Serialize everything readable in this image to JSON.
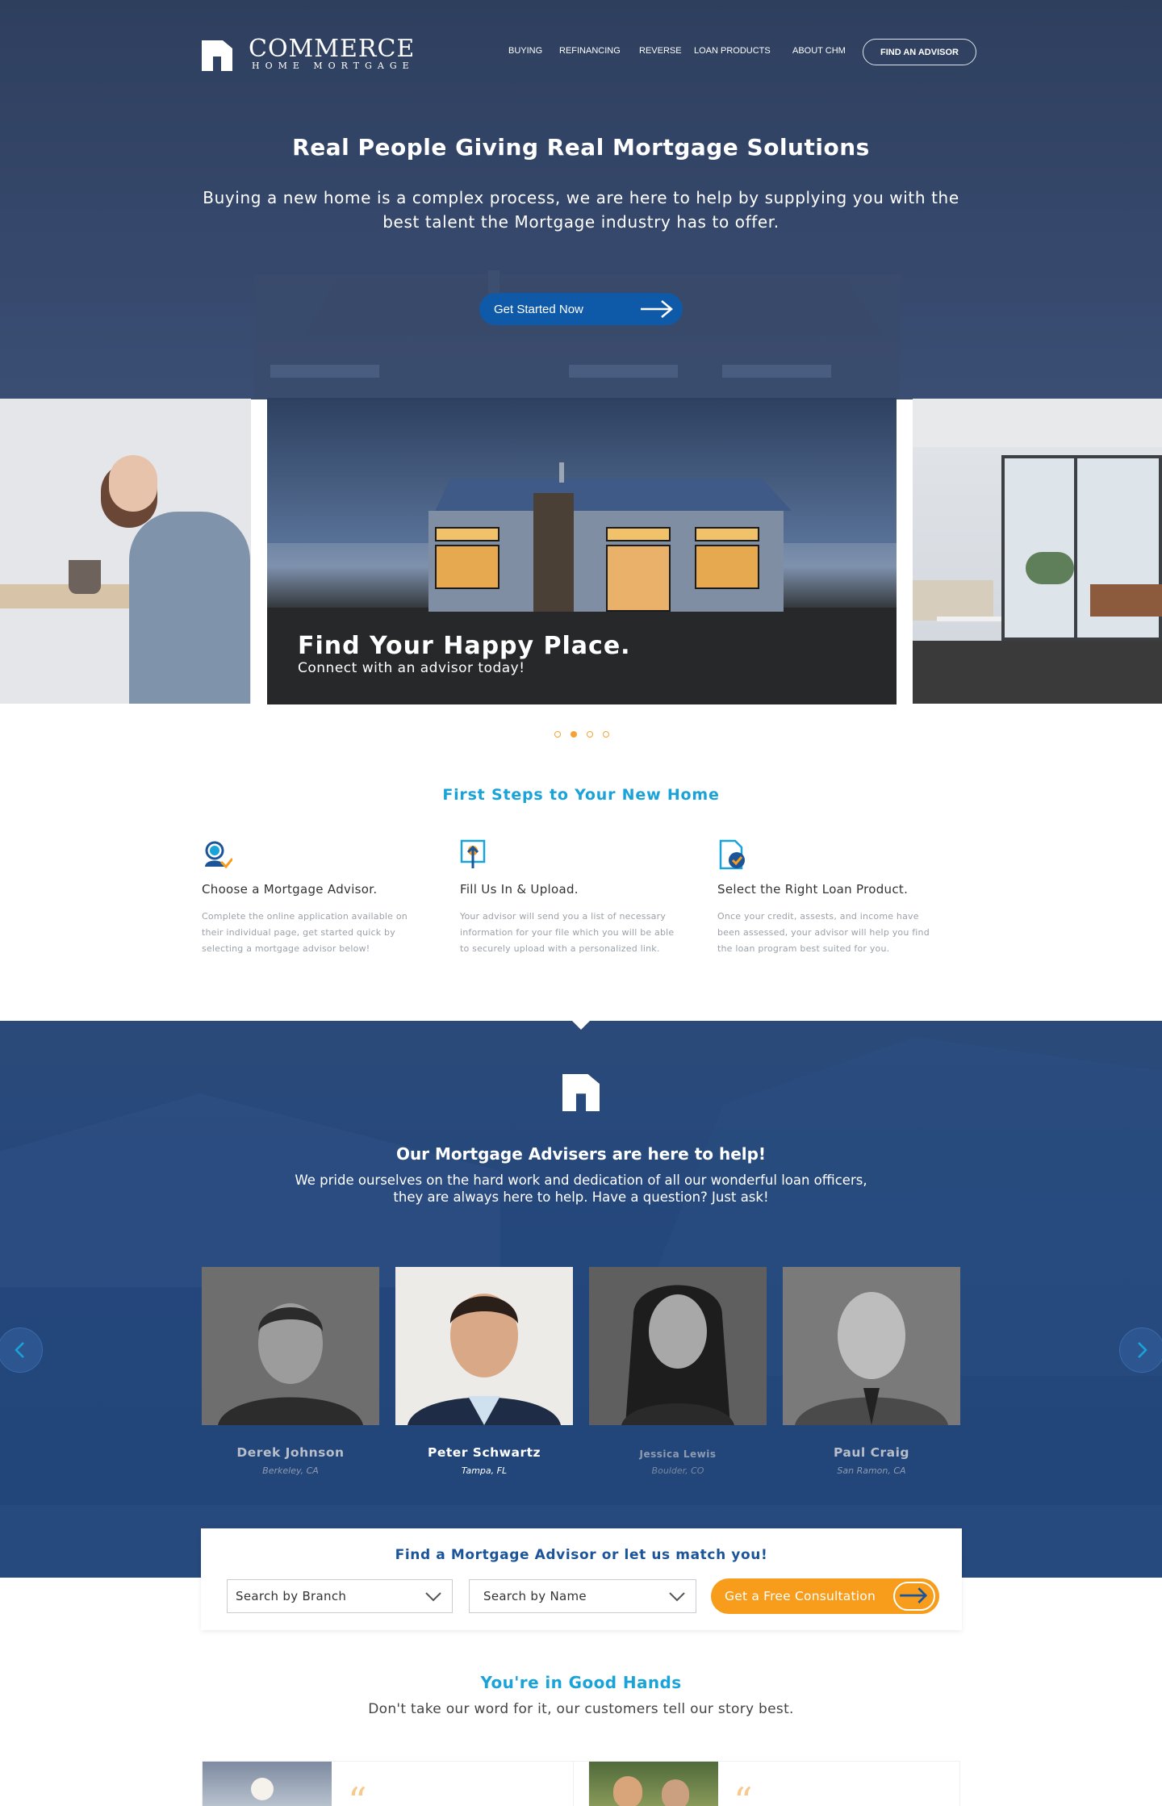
{
  "brand": {
    "name": "COMMERCE",
    "tagline": "HOME MORTGAGE",
    "logo_icon": "house-logo-icon",
    "colors": {
      "navy": "#2e3f5e",
      "blue": "#0f5aa8",
      "cyan": "#1aa3d8",
      "orange": "#f79d1b"
    }
  },
  "nav": {
    "items": [
      "BUYING",
      "REFINANCING",
      "REVERSE",
      "LOAN PRODUCTS",
      "ABOUT CHM"
    ],
    "cta": "FIND AN ADVISOR"
  },
  "hero": {
    "title": "Real People Giving Real Mortgage Solutions",
    "subtitle": "Buying a new home is a complex process, we are here to help by supplying you with the best talent the Mortgage industry has to offer.",
    "cta": "Get Started Now"
  },
  "carousel": {
    "title": "Find Your Happy Place.",
    "subtitle": "Connect with an advisor today!",
    "active_index": 1,
    "dot_count": 4
  },
  "steps": {
    "title": "First Steps to Your New Home",
    "items": [
      {
        "icon": "advisor-headset-icon",
        "title": "Choose a Mortgage Advisor.",
        "body": "Complete the online application available on their individual page, get started quick by selecting a mortgage advisor below!"
      },
      {
        "icon": "upload-icon",
        "title": "Fill Us In & Upload.",
        "body": "Your advisor will send you a list of necessary information for your file which you will be able to securely upload with a personalized link."
      },
      {
        "icon": "document-check-icon",
        "title": "Select the Right Loan Product.",
        "body": "Once your credit, assests, and income have been assessed, your advisor will help you find the loan program best suited for you."
      }
    ]
  },
  "advisors": {
    "title": "Our Mortgage Advisers are here to help!",
    "subtitle": "We pride ourselves on the hard work and dedication of all our wonderful loan officers, they are always here to help. Have a question? Just ask!",
    "people": [
      {
        "name": "Derek Johnson",
        "city": "Berkeley, CA"
      },
      {
        "name": "Peter Schwartz",
        "city": "Tampa, FL"
      },
      {
        "name": "Jessica Lewis",
        "city": "Boulder, CO"
      },
      {
        "name": "Paul Craig",
        "city": "San Ramon, CA"
      }
    ]
  },
  "search": {
    "title": "Find a Mortgage Advisor or let us match you!",
    "branch_placeholder": "Search by Branch",
    "name_placeholder": "Search by Name",
    "cta": "Get a Free Consultation"
  },
  "testimonials": {
    "title": "You're in Good Hands",
    "subtitle": "Don't take our word for it, our customers tell our story best.",
    "quote_mark": "“"
  }
}
